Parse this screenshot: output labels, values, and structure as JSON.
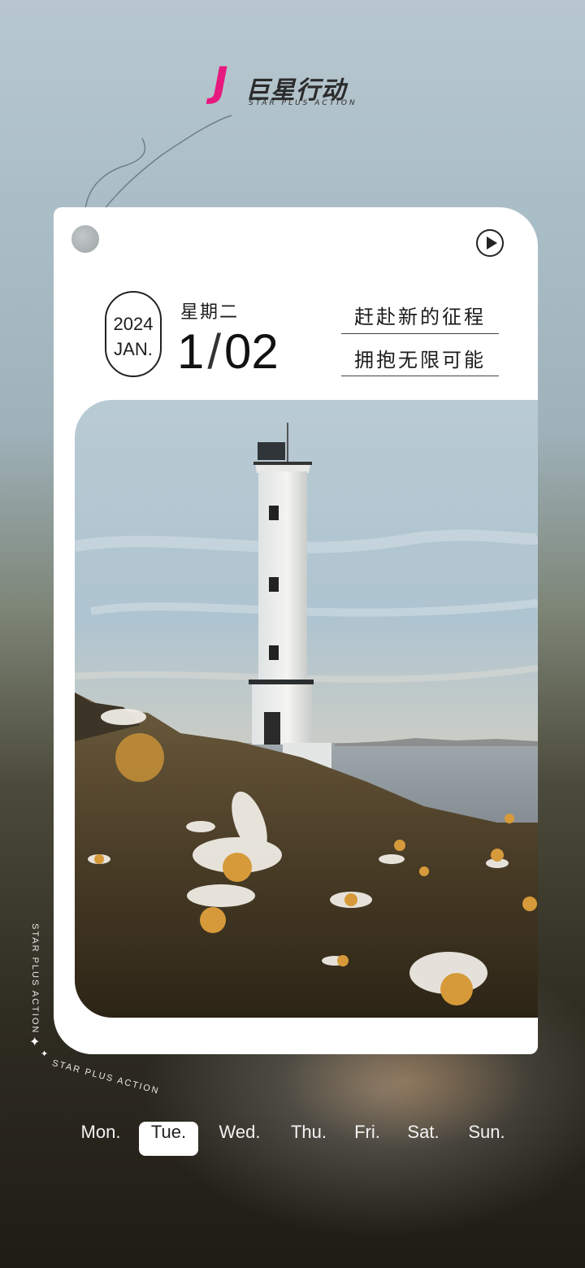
{
  "logo": {
    "mark": "J",
    "name": "巨星行动",
    "tagline": "STAR PLUS ACTION"
  },
  "date": {
    "year": "2024",
    "month": "JAN.",
    "weekday": "星期二",
    "month_num": "1",
    "separator": "/",
    "day": "02"
  },
  "slogan": {
    "line1": "赶赴新的征程",
    "line2": "拥抱无限可能"
  },
  "side_text": "STAR PLUS ACTION",
  "bottom_text": "STAR PLUS ACTION",
  "week": [
    {
      "label": "Mon.",
      "active": false
    },
    {
      "label": "Tue.",
      "active": true
    },
    {
      "label": "Wed.",
      "active": false
    },
    {
      "label": "Thu.",
      "active": false
    },
    {
      "label": "Fri.",
      "active": false
    },
    {
      "label": "Sat.",
      "active": false
    },
    {
      "label": "Sun.",
      "active": false
    }
  ],
  "icons": {
    "play": "play-icon",
    "hole": "hang-hole-icon",
    "sparkle": "sparkle-icon"
  },
  "colors": {
    "brand": "#e6197f",
    "card": "#ffffff",
    "text": "#1c1c1c"
  }
}
